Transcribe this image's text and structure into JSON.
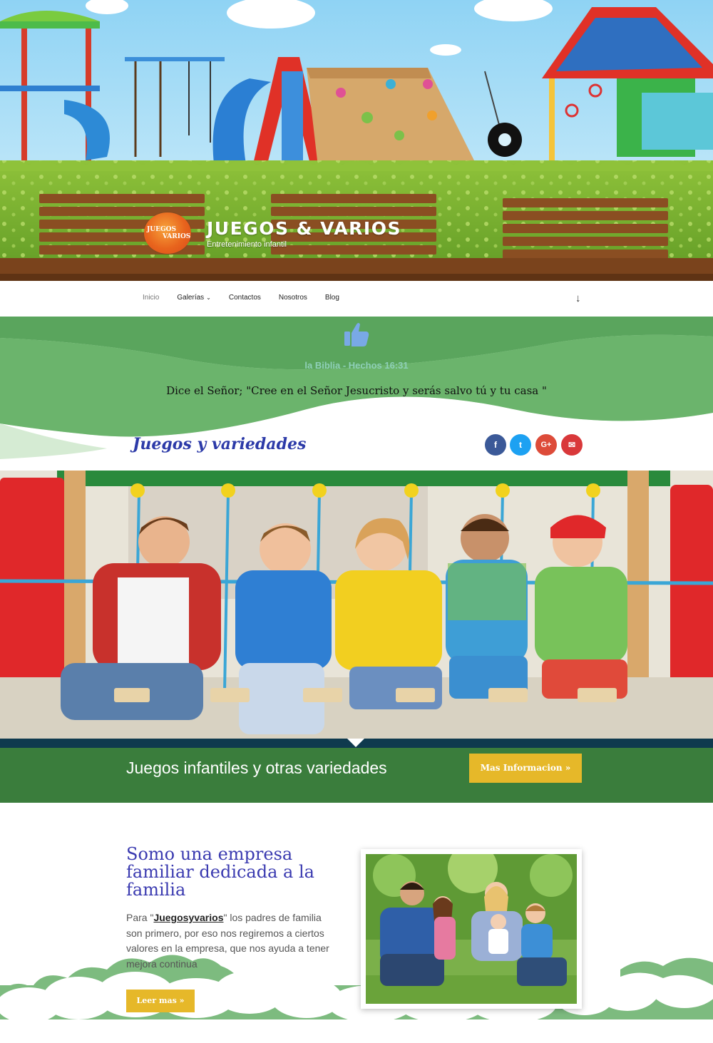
{
  "site": {
    "title": "JUEGOS & VARIOS",
    "tagline": "Entretenimiento infantil",
    "logo_text_top": "JUEGOS",
    "logo_text_bottom": "VARIOS"
  },
  "nav": {
    "items": [
      {
        "label": "Inicio",
        "active": true
      },
      {
        "label": "Galerías",
        "has_dropdown": true
      },
      {
        "label": "Contactos"
      },
      {
        "label": "Nosotros"
      },
      {
        "label": "Blog"
      }
    ],
    "scroll_icon": "arrow-down-icon"
  },
  "quote": {
    "icon": "thumbs-up-icon",
    "reference": "la Biblia - Hechos 16:31",
    "text": "Dice el Señor; \"Cree en el Señor Jesucristo y serás salvo tú y tu casa \""
  },
  "section": {
    "title": "Juegos y variedades",
    "social": [
      {
        "name": "facebook-icon",
        "glyph": "f",
        "color": "#3b5998"
      },
      {
        "name": "twitter-icon",
        "glyph": "t",
        "color": "#1da1f2"
      },
      {
        "name": "google-plus-icon",
        "glyph": "G+",
        "color": "#dd4b39"
      },
      {
        "name": "email-icon",
        "glyph": "✉",
        "color": "#d9383a"
      }
    ]
  },
  "cta": {
    "text": "Juegos infantiles y otras variedades",
    "button": "Mas Informacion »"
  },
  "about": {
    "title": "Somo una empresa familiar dedicada a la familia",
    "body_prefix": "Para \"",
    "body_brand": "Juegosyvarios",
    "body_suffix": "\" los padres de familia son primero, por eso nos regiremos a ciertos valores en la empresa, que nos ayuda a tener mejora continua",
    "button": "Leer mas »"
  },
  "colors": {
    "green_band": "#3a7d3c",
    "yellow_button": "#e6b829",
    "title_blue": "#3a3ab0",
    "dark_strip": "#0f3a4e"
  }
}
